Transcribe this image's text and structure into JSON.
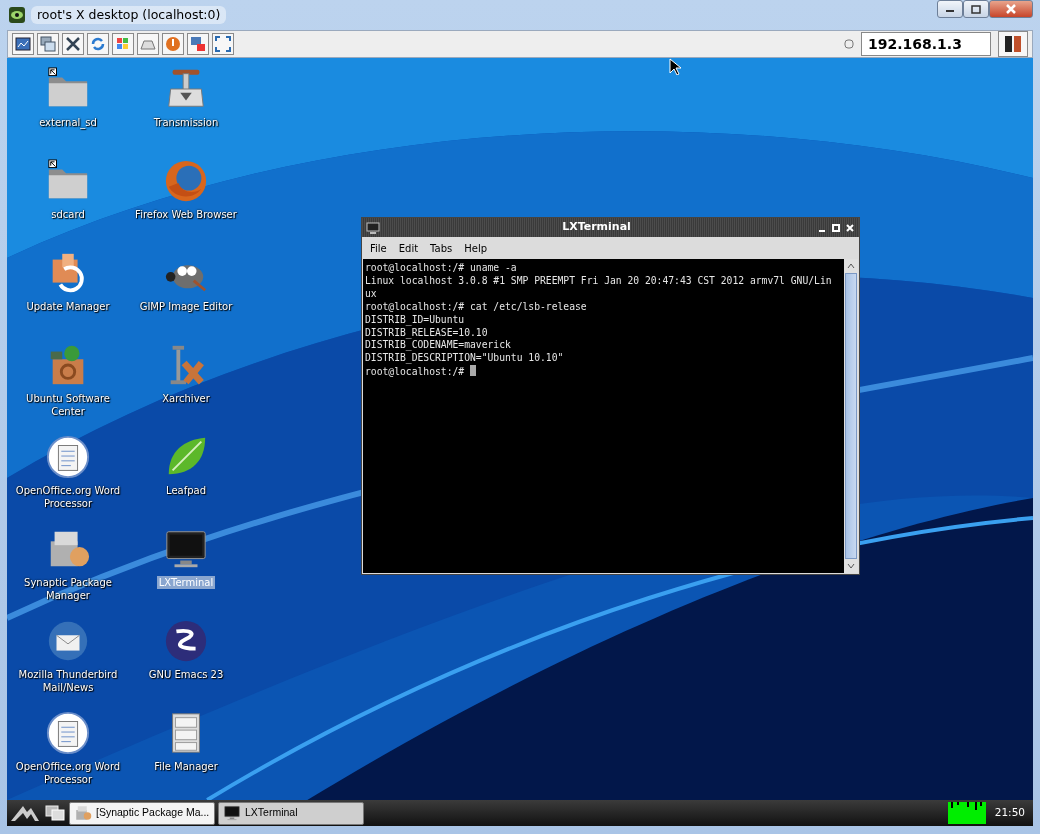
{
  "window": {
    "title": "root's X desktop (localhost:0)"
  },
  "toolbar": {
    "option": {
      "selected": false
    },
    "address": "192.168.1.3"
  },
  "desktop": {
    "icons": [
      {
        "label": "external_sd",
        "kind": "folder",
        "selected": false
      },
      {
        "label": "Transmission",
        "kind": "transmission",
        "selected": false
      },
      {
        "label": "sdcard",
        "kind": "folder",
        "selected": false
      },
      {
        "label": "Firefox Web Browser",
        "kind": "firefox",
        "selected": false
      },
      {
        "label": "Update Manager",
        "kind": "update",
        "selected": false
      },
      {
        "label": "GIMP Image Editor",
        "kind": "gimp",
        "selected": false
      },
      {
        "label": "Ubuntu Software Center",
        "kind": "software",
        "selected": false
      },
      {
        "label": "Xarchiver",
        "kind": "xarchiver",
        "selected": false
      },
      {
        "label": "OpenOffice.org Word Processor",
        "kind": "writer",
        "selected": false
      },
      {
        "label": "Leafpad",
        "kind": "leafpad",
        "selected": false
      },
      {
        "label": "Synaptic Package Manager",
        "kind": "synaptic",
        "selected": false
      },
      {
        "label": "LXTerminal",
        "kind": "monitor",
        "selected": true
      },
      {
        "label": "Mozilla Thunderbird Mail/News",
        "kind": "thunderbird",
        "selected": false
      },
      {
        "label": "GNU Emacs 23",
        "kind": "emacs",
        "selected": false
      },
      {
        "label": "OpenOffice.org Word Processor",
        "kind": "writer",
        "selected": false
      },
      {
        "label": "File Manager",
        "kind": "cabinet",
        "selected": false
      }
    ]
  },
  "terminal": {
    "title": "LXTerminal",
    "menu": [
      "File",
      "Edit",
      "Tabs",
      "Help"
    ],
    "lines": [
      "root@localhost:/# uname -a",
      "Linux localhost 3.0.8 #1 SMP PREEMPT Fri Jan 20 20:47:43 CST 2012 armv7l GNU/Lin",
      "ux",
      "root@localhost:/# cat /etc/lsb-release",
      "DISTRIB_ID=Ubuntu",
      "DISTRIB_RELEASE=10.10",
      "DISTRIB_CODENAME=maverick",
      "DISTRIB_DESCRIPTION=\"Ubuntu 10.10\"",
      "root@localhost:/# "
    ]
  },
  "taskbar": {
    "tasks": [
      {
        "label": "[Synaptic Package Ma...",
        "kind": "synaptic",
        "selected": true
      },
      {
        "label": "LXTerminal",
        "kind": "monitor",
        "selected": false
      }
    ],
    "clock": "21:50"
  }
}
